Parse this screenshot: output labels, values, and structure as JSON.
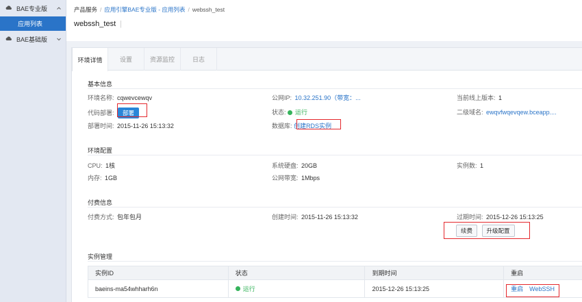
{
  "sidebar": {
    "groups": [
      {
        "label": "BAE专业版",
        "expanded": true
      },
      {
        "label": "BAE基础版",
        "expanded": false
      }
    ],
    "active_item": "应用列表"
  },
  "breadcrumb": {
    "root": "产品服务",
    "middle": "应用引擎BAE专业版 - 应用列表",
    "current": "webssh_test",
    "separator": "/"
  },
  "page_title": "webssh_test",
  "tabs": [
    "环境详情",
    "设置",
    "资源监控",
    "日志"
  ],
  "basic": {
    "title": "基本信息",
    "env_name_label": "环境名称:",
    "env_name": "cqwevcewqv",
    "deploy_label": "代码部署:",
    "deploy_button": "部署",
    "deploy_time_label": "部署时间:",
    "deploy_time": "2015-11-26 15:13:32",
    "public_ip_label": "公网IP:",
    "public_ip": "10.32.251.90（带宽：...",
    "status_label": "状态:",
    "status": "运行",
    "database_label": "数据库:",
    "database_link": "创建RDS实例",
    "online_version_label": "当前线上版本:",
    "online_version": "1",
    "subdomain_label": "二级域名:",
    "subdomain": "ewqvfwqevqew.bceapp...."
  },
  "env_config": {
    "title": "环境配置",
    "cpu_label": "CPU:",
    "cpu": "1核",
    "mem_label": "内存:",
    "mem": "1GB",
    "disk_label": "系统硬盘:",
    "disk": "20GB",
    "bandwidth_label": "公网带宽:",
    "bandwidth": "1Mbps",
    "instances_label": "实例数:",
    "instances": "1"
  },
  "billing": {
    "title": "付费信息",
    "method_label": "付费方式:",
    "method": "包年包月",
    "created_label": "创建时间:",
    "created": "2015-11-26 15:13:32",
    "expire_label": "过期时间:",
    "expire": "2015-12-26 15:13:25",
    "renew_button": "续费",
    "upgrade_button": "升级配置"
  },
  "instances": {
    "title": "实例管理",
    "headers": [
      "实例ID",
      "状态",
      "到期时间",
      "重启"
    ],
    "rows": [
      {
        "id": "baeins-ma54whharh6n",
        "status": "运行",
        "expire": "2015-12-26 15:13:25",
        "action1": "重启",
        "action2": "WebSSH"
      }
    ]
  },
  "colors": {
    "accent": "#2a74c8",
    "status_ok": "#35b35b",
    "highlight_box": "#e4262b"
  }
}
